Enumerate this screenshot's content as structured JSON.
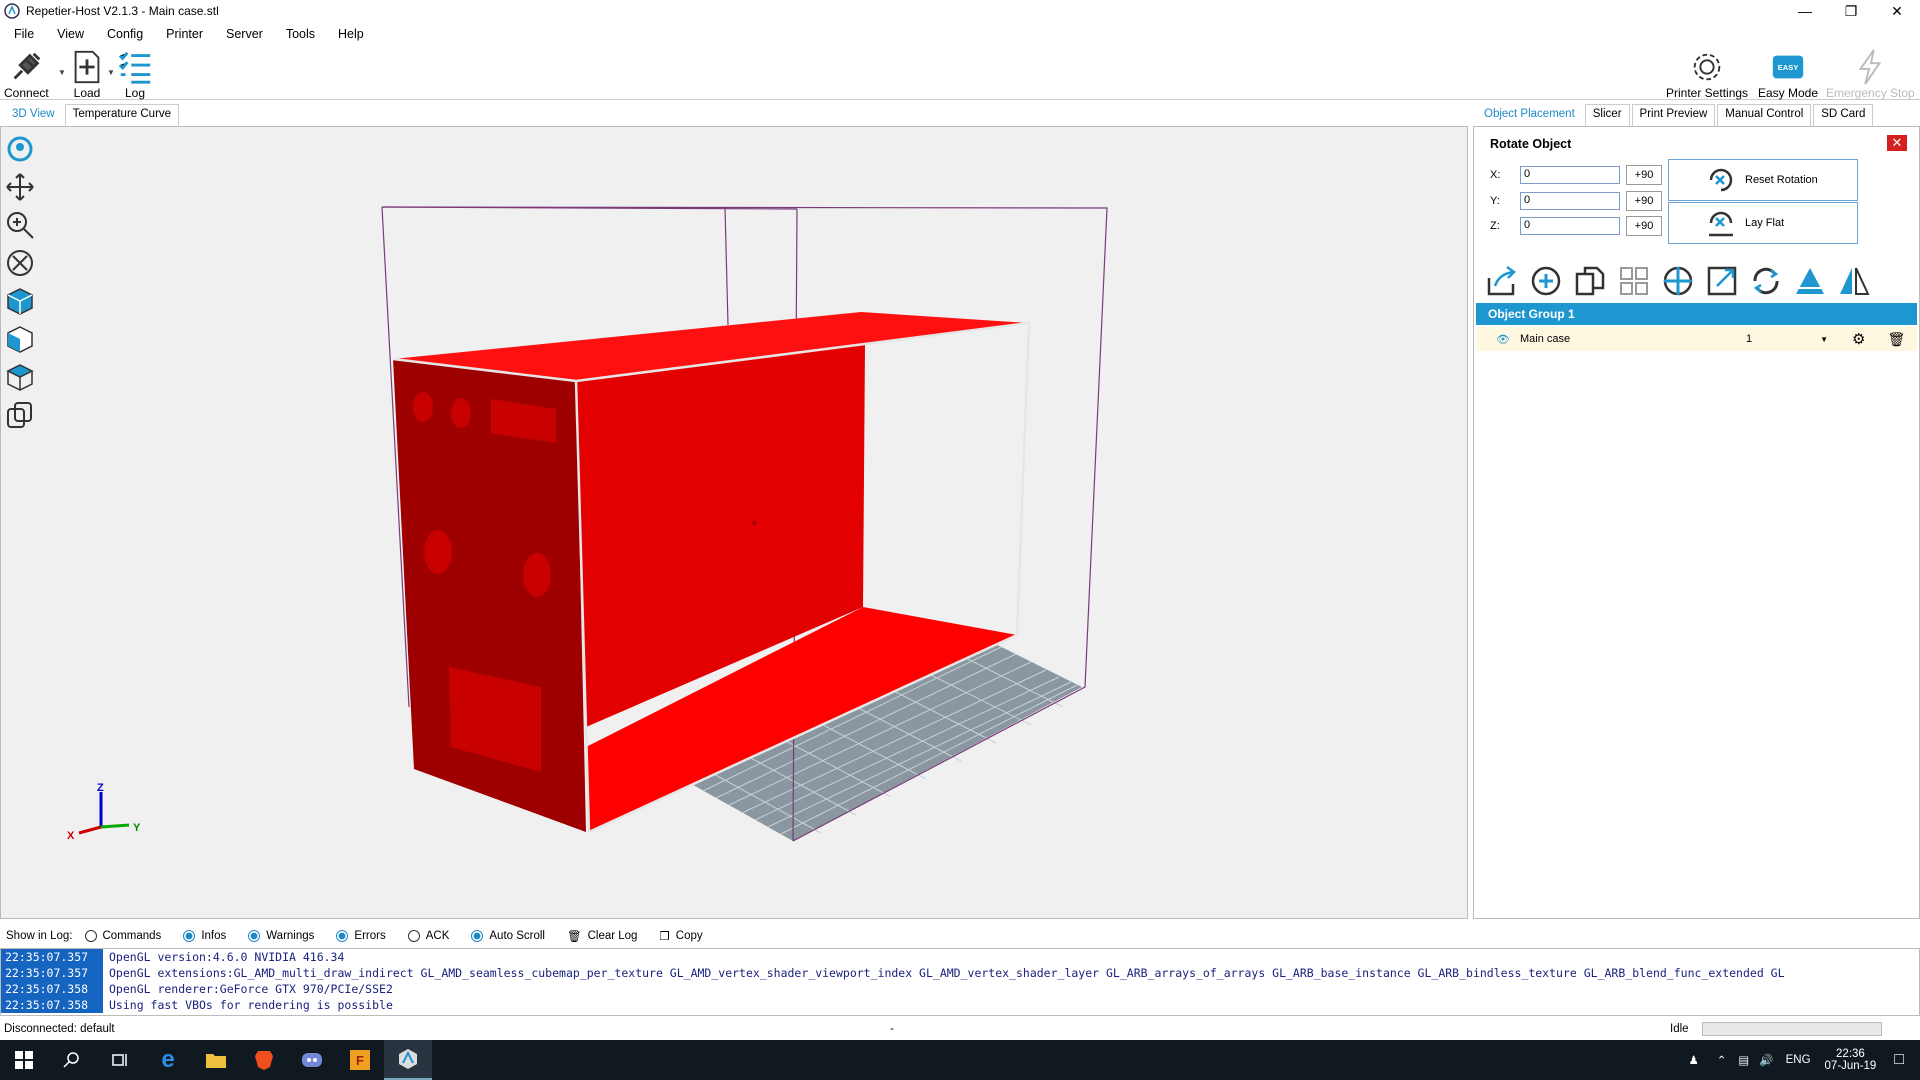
{
  "window": {
    "title": "Repetier-Host V2.1.3 - Main case.stl"
  },
  "menu": [
    "File",
    "View",
    "Config",
    "Printer",
    "Server",
    "Tools",
    "Help"
  ],
  "toolbar": {
    "connect": "Connect",
    "load": "Load",
    "log": "Log",
    "printer_settings": "Printer Settings",
    "easy_mode": "Easy Mode",
    "easy_badge": "EASY",
    "emergency_stop": "Emergency Stop"
  },
  "view_tabs": [
    "3D View",
    "Temperature Curve"
  ],
  "panel_tabs": [
    "Object Placement",
    "Slicer",
    "Print Preview",
    "Manual Control",
    "SD Card"
  ],
  "rotate": {
    "header": "Rotate Object",
    "x_label": "X:",
    "y_label": "Y:",
    "z_label": "Z:",
    "x": "0",
    "y": "0",
    "z": "0",
    "plus90": "+90",
    "reset_rotation": "Reset Rotation",
    "lay_flat": "Lay Flat"
  },
  "objects": {
    "group": "Object Group 1",
    "item_name": "Main case",
    "item_count": "1"
  },
  "log": {
    "show_in_log": "Show in Log:",
    "commands": "Commands",
    "infos": "Infos",
    "warnings": "Warnings",
    "errors": "Errors",
    "ack": "ACK",
    "auto_scroll": "Auto Scroll",
    "clear_log": "Clear Log",
    "copy": "Copy",
    "lines": [
      {
        "ts": "22:35:07.357",
        "msg": "OpenGL version:4.6.0 NVIDIA 416.34"
      },
      {
        "ts": "22:35:07.357",
        "msg": "OpenGL extensions:GL_AMD_multi_draw_indirect GL_AMD_seamless_cubemap_per_texture GL_AMD_vertex_shader_viewport_index GL_AMD_vertex_shader_layer GL_ARB_arrays_of_arrays GL_ARB_base_instance GL_ARB_bindless_texture GL_ARB_blend_func_extended GL"
      },
      {
        "ts": "22:35:07.358",
        "msg": "OpenGL renderer:GeForce GTX 970/PCIe/SSE2"
      },
      {
        "ts": "22:35:07.358",
        "msg": "Using fast VBOs for rendering is possible"
      }
    ]
  },
  "status": {
    "connection": "Disconnected: default",
    "middle": "-",
    "state": "Idle"
  },
  "axes": {
    "x": "X",
    "y": "Y",
    "z": "Z"
  },
  "taskbar": {
    "lang": "ENG",
    "time": "22:36",
    "date": "07-Jun-19"
  },
  "colors": {
    "accent": "#1e96d0",
    "object_red": "#ff0000",
    "close_red": "#d62020"
  }
}
